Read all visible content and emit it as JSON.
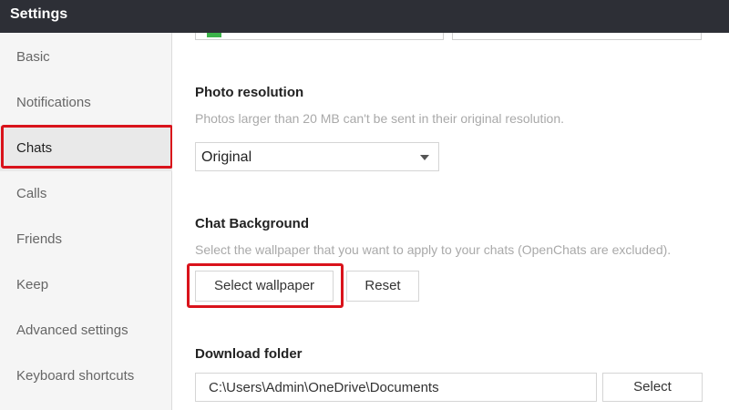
{
  "window": {
    "title": "Settings"
  },
  "sidebar": {
    "items": [
      {
        "label": "Basic"
      },
      {
        "label": "Notifications"
      },
      {
        "label": "Chats"
      },
      {
        "label": "Calls"
      },
      {
        "label": "Friends"
      },
      {
        "label": "Keep"
      },
      {
        "label": "Advanced settings"
      },
      {
        "label": "Keyboard shortcuts"
      }
    ],
    "active": "Chats"
  },
  "photo_resolution": {
    "title": "Photo resolution",
    "description": "Photos larger than 20 MB can't be sent in their original resolution.",
    "selected": "Original"
  },
  "chat_background": {
    "title": "Chat Background",
    "description": "Select the wallpaper that you want to apply to your chats (OpenChats are excluded).",
    "select_button": "Select wallpaper",
    "reset_button": "Reset"
  },
  "download_folder": {
    "title": "Download folder",
    "path": "C:\\Users\\Admin\\OneDrive\\Documents",
    "select_button": "Select"
  },
  "colors": {
    "titlebar": "#2d2f36",
    "highlight": "#d9131b",
    "sidebar_bg": "#f5f5f5"
  }
}
